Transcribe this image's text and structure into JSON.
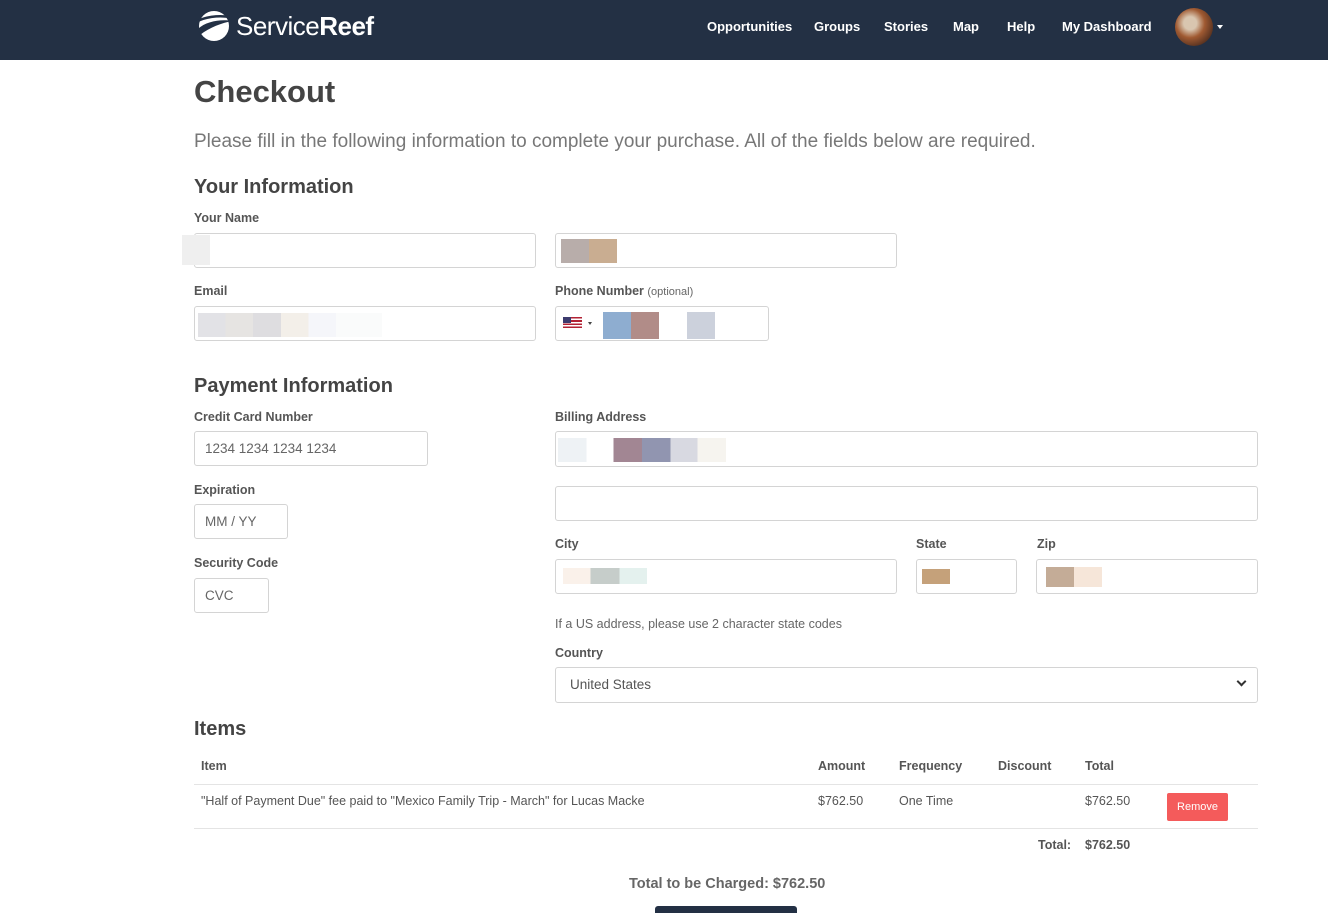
{
  "nav": {
    "brand_light": "Service",
    "brand_bold": "Reef",
    "links": [
      "Opportunities",
      "Groups",
      "Stories",
      "Map",
      "Help",
      "My Dashboard"
    ]
  },
  "page": {
    "title": "Checkout",
    "lead": "Please fill in the following information to complete your purchase. All of the fields below are required."
  },
  "your_info": {
    "heading": "Your Information",
    "name_label": "Your Name",
    "email_label": "Email",
    "phone_label": "Phone Number",
    "phone_optional": "(optional)"
  },
  "payment": {
    "heading": "Payment Information",
    "card_label": "Credit Card Number",
    "card_placeholder": "1234 1234 1234 1234",
    "expiration_label": "Expiration",
    "expiration_placeholder": "MM / YY",
    "security_label": "Security Code",
    "security_placeholder": "CVC",
    "billing_label": "Billing Address",
    "city_label": "City",
    "state_label": "State",
    "zip_label": "Zip",
    "state_help": "If a US address, please use 2 character state codes",
    "country_label": "Country",
    "country_value": "United States"
  },
  "items": {
    "heading": "Items",
    "columns": [
      "Item",
      "Amount",
      "Frequency",
      "Discount",
      "Total"
    ],
    "rows": [
      {
        "item": "\"Half of Payment Due\" fee paid to \"Mexico Family Trip - March\" for Lucas Macke",
        "amount": "$762.50",
        "frequency": "One Time",
        "discount": "",
        "total": "$762.50",
        "action": "Remove"
      }
    ],
    "total_label": "Total:",
    "total_value": "$762.50",
    "charge_text": "Total to be Charged: $762.50"
  },
  "colors": {
    "nav_bg": "#233044",
    "remove_button": "#f45b5b"
  }
}
